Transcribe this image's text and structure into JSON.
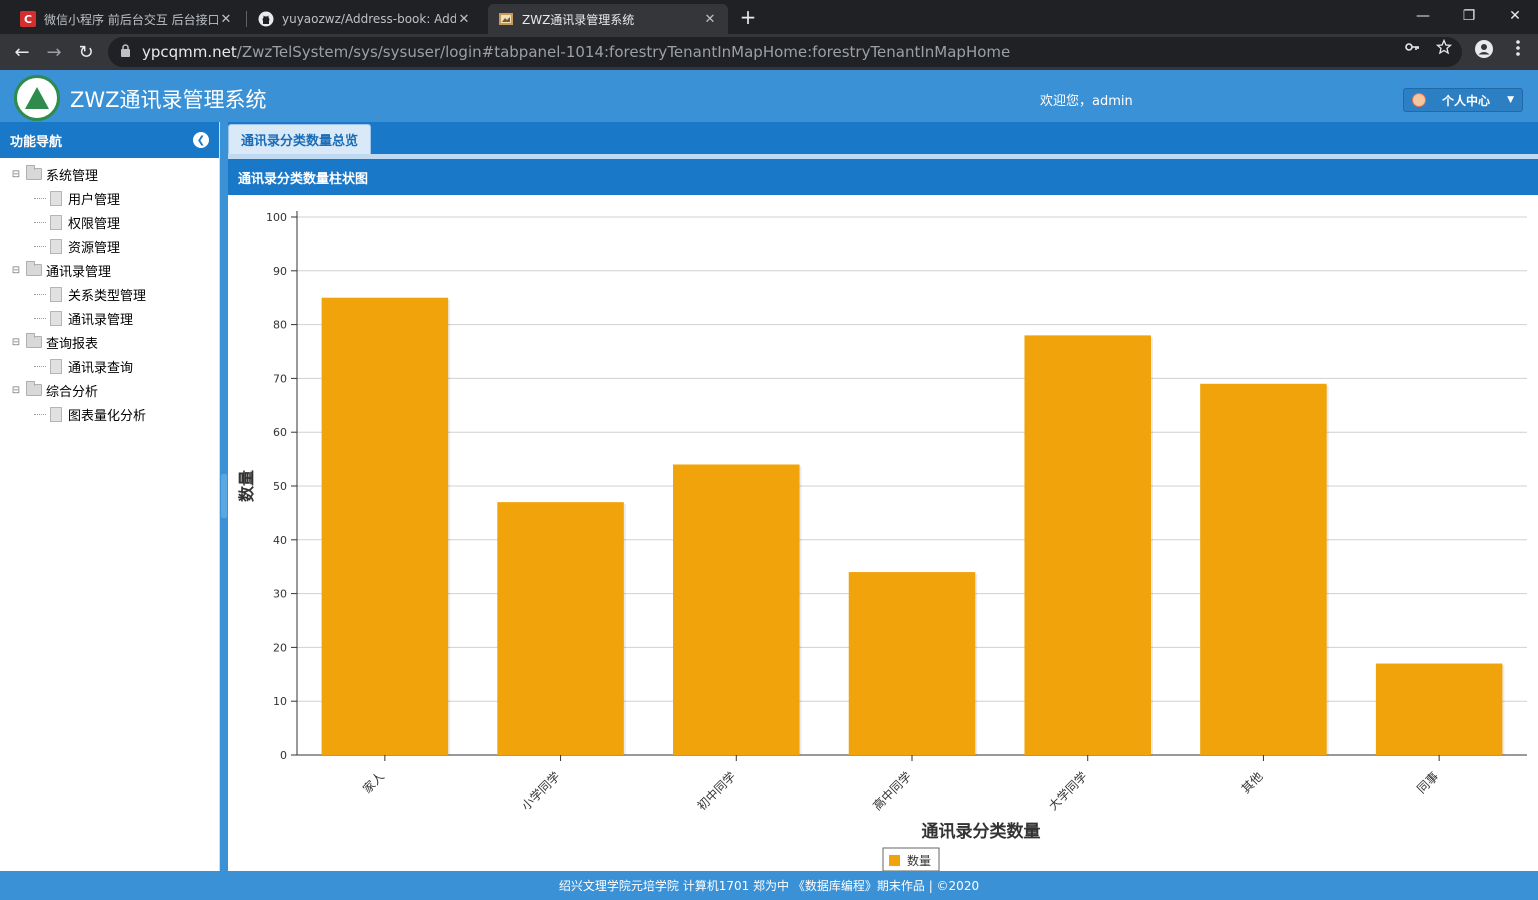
{
  "browser": {
    "tabs": [
      {
        "title": "微信小程序 前后台交互 后台接口",
        "favicon": "C",
        "favicon_color": "#d32f2f"
      },
      {
        "title": "yuyaozwz/Address-book: Address",
        "favicon": "github-icon",
        "favicon_color": "#ffffff"
      },
      {
        "title": "ZWZ通讯录管理系统",
        "favicon": "page-icon",
        "favicon_color": "#c69a5c"
      }
    ],
    "close_glyph": "✕",
    "new_tab_glyph": "+",
    "window_controls": [
      "—",
      "❐",
      "✕"
    ],
    "nav": {
      "back": "←",
      "forward": "→",
      "reload": "↻"
    },
    "url_host": "ypcqmm.net",
    "url_path": "/ZwzTelSystem/sys/sysuser/login#tabpanel-1014:forestryTenantInMapHome:forestryTenantInMapHome",
    "omnibox_icons": [
      "key-icon",
      "star-icon",
      "account-icon",
      "menu-icon"
    ]
  },
  "app": {
    "title": "ZWZ通讯录管理系统",
    "welcome": "欢迎您，admin",
    "user_menu_label": "个人中心",
    "accent": "#3a91d6",
    "dark_accent": "#1978c8"
  },
  "sidebar": {
    "title": "功能导航",
    "groups": [
      {
        "label": "系统管理",
        "items": [
          "用户管理",
          "权限管理",
          "资源管理"
        ]
      },
      {
        "label": "通讯录管理",
        "items": [
          "关系类型管理",
          "通讯录管理"
        ]
      },
      {
        "label": "查询报表",
        "items": [
          "通讯录查询"
        ]
      },
      {
        "label": "综合分析",
        "items": [
          "图表量化分析"
        ]
      }
    ]
  },
  "main": {
    "tab_label": "通讯录分类数量总览",
    "panel_title": "通讯录分类数量柱状图"
  },
  "chart_data": {
    "type": "bar",
    "categories": [
      "家人",
      "小学同学",
      "初中同学",
      "高中同学",
      "大学同学",
      "其他",
      "同事"
    ],
    "series": [
      {
        "name": "数量",
        "values": [
          85,
          47,
          54,
          34,
          78,
          69,
          17
        ],
        "color": "#f0a30a"
      }
    ],
    "xlabel": "通讯录分类数量",
    "ylabel": "数量",
    "ylim": [
      0,
      100
    ],
    "yticks": [
      0,
      10,
      20,
      30,
      40,
      50,
      60,
      70,
      80,
      90,
      100
    ],
    "grid": true,
    "legend": "bottom-center"
  },
  "footer": {
    "text": "绍兴文理学院元培学院 计算机1701 郑为中 《数据库编程》期末作品 | ©2020"
  }
}
